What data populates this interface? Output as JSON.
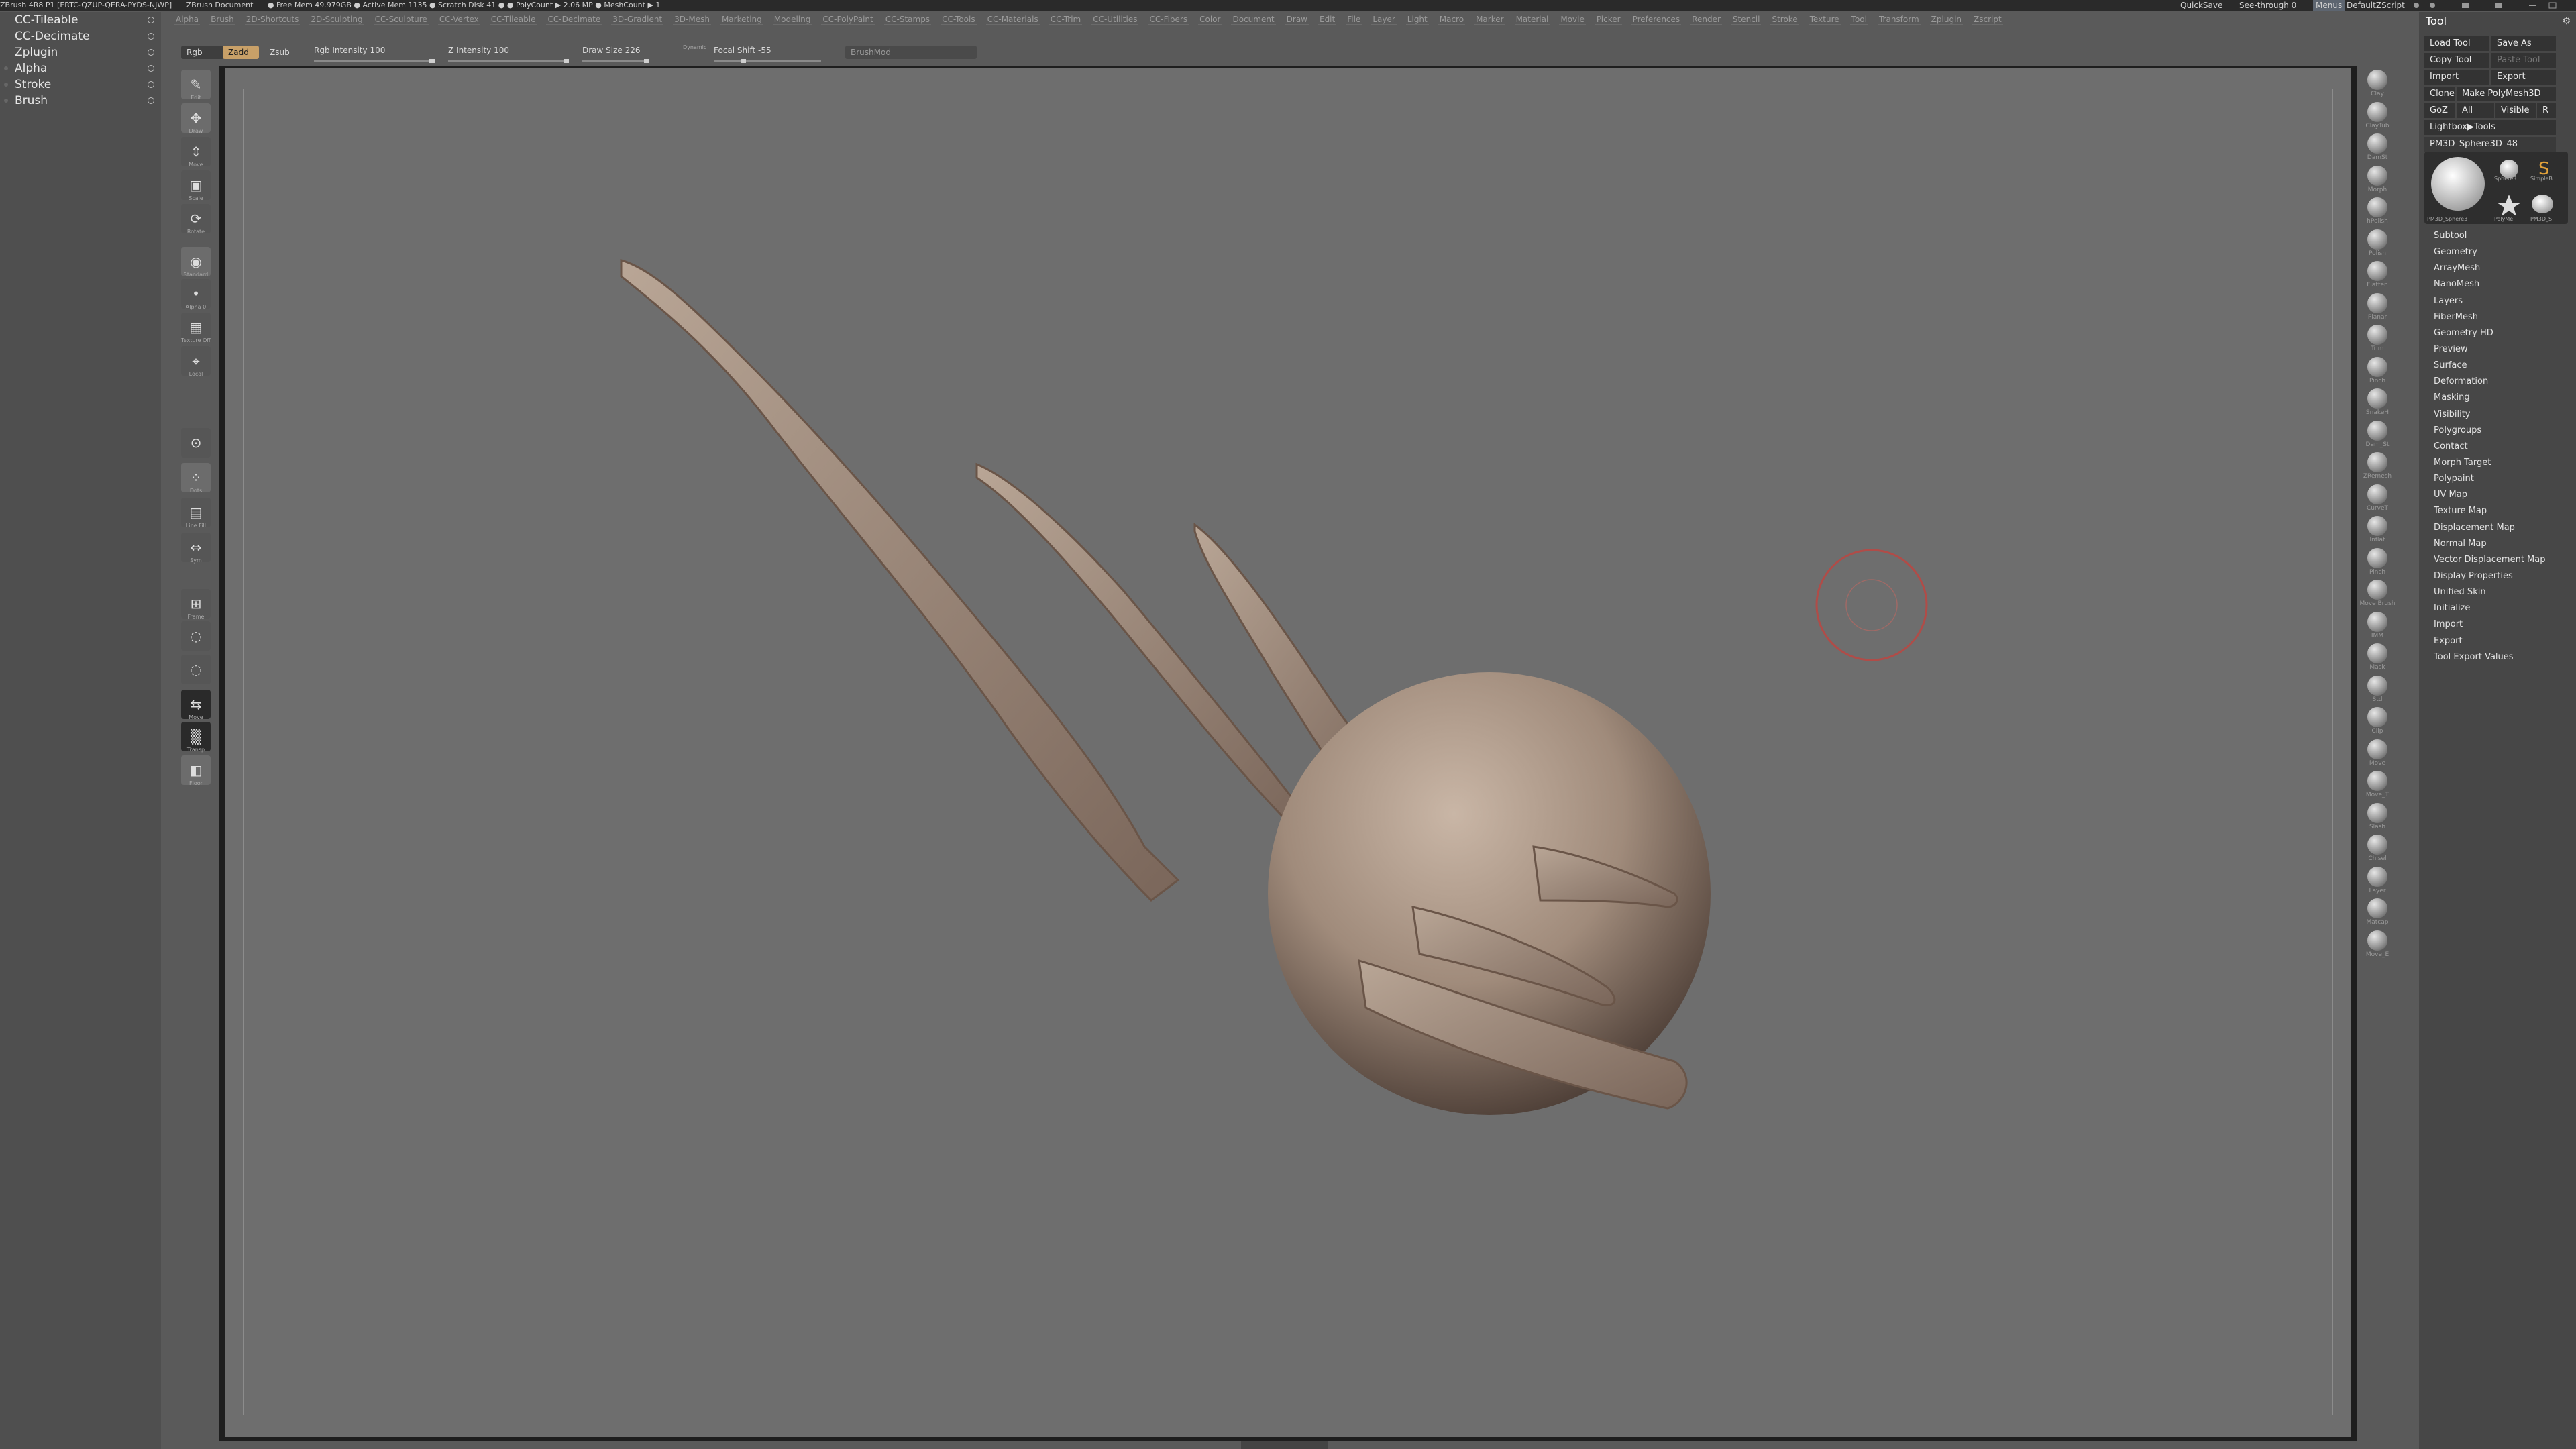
{
  "titlebar": {
    "app": "ZBrush 4R8 P1 [ERTC-QZUP-QERA-PYDS-NJWP]",
    "doc": "ZBrush Document",
    "stats": "● Free Mem 49.979GB ● Active Mem 1135 ● Scratch Disk 41 ● ● PolyCount ▶ 2.06 MP ● MeshCount ▶ 1",
    "quicksave": "QuickSave",
    "seethrough": "See-through 0",
    "menus": "Menus",
    "script": "DefaultZScript"
  },
  "menubar": [
    "Alpha",
    "Brush",
    "2D-Shortcuts",
    "2D-Sculpting",
    "CC-Sculpture",
    "CC-Vertex",
    "CC-Tileable",
    "CC-Decimate",
    "3D-Gradient",
    "3D-Mesh",
    "Marketing",
    "Modeling",
    "CC-PolyPaint",
    "CC-Stamps",
    "CC-Tools",
    "CC-Materials",
    "CC-Trim",
    "CC-Utilities",
    "CC-Fibers",
    "Color",
    "Document",
    "Draw",
    "Edit",
    "File",
    "Layer",
    "Light",
    "Macro",
    "Marker",
    "Material",
    "Movie",
    "Picker",
    "Preferences",
    "Render",
    "Stencil",
    "Stroke",
    "Texture",
    "Tool",
    "Transform",
    "Zplugin",
    "Zscript"
  ],
  "left_palettes": [
    {
      "label": "CC-Tileable",
      "marker": false
    },
    {
      "label": "CC-Decimate",
      "marker": false
    },
    {
      "label": "Zplugin",
      "marker": false
    },
    {
      "label": "Alpha",
      "marker": true
    },
    {
      "label": "Stroke",
      "marker": true
    },
    {
      "label": "Brush",
      "marker": true
    }
  ],
  "topshelf": {
    "rgb": "Rgb",
    "zadd": "Zadd",
    "zsub": "Zsub",
    "rgb_intensity_label": "Rgb Intensity",
    "rgb_intensity": "100",
    "z_intensity_label": "Z Intensity",
    "z_intensity": "100",
    "draw_size_label": "Draw Size",
    "draw_size": "226",
    "dynamic": "Dynamic",
    "focal_shift_label": "Focal Shift",
    "focal_shift": "-55",
    "brush_mod": "BrushMod"
  },
  "left_toolbar": [
    "Edit",
    "Draw",
    "Move",
    "Scale",
    "Rotate",
    "Standard",
    "Alpha 0",
    "Texture Off",
    "Local",
    "",
    "Dots",
    "Line Fill",
    "Sym",
    "Frame",
    "",
    "",
    "Move",
    "Transp",
    "Floor"
  ],
  "right_brushes": [
    "Clay",
    "ClayTub",
    "DamSt",
    "Morph",
    "hPolish",
    "Polish",
    "Flatten",
    "Planar",
    "Trim",
    "Pinch",
    "SnakeH",
    "Dam_St",
    "ZRemesh",
    "CurveT",
    "Inflat",
    "Pinch",
    "Move Brush",
    "IMM",
    "Mask",
    "Std",
    "Clip",
    "Move",
    "Move_T",
    "Slash",
    "Chisel",
    "Layer",
    "Matcap",
    "Move_E"
  ],
  "toolpanel": {
    "title": "Tool",
    "load_tool": "Load Tool",
    "save_as": "Save As",
    "copy_tool": "Copy Tool",
    "paste_tool": "Paste Tool",
    "import": "Import",
    "export": "Export",
    "clone": "Clone",
    "make_polymesh": "Make PolyMesh3D",
    "goz": "GoZ",
    "all": "All",
    "visible": "Visible",
    "r": "R",
    "lightbox_tools": "Lightbox▶Tools",
    "current_tool": "PM3D_Sphere3D_48",
    "thumb1": "PM3D_Sphere3",
    "thumb2": "Sphere3",
    "thumb3": "SimpleB",
    "thumb4": "PolyMe",
    "thumb5": "PM3D_S",
    "sections": [
      "Subtool",
      "Geometry",
      "ArrayMesh",
      "NanoMesh",
      "Layers",
      "FiberMesh",
      "Geometry HD",
      "Preview",
      "Surface",
      "Deformation",
      "Masking",
      "Visibility",
      "Polygroups",
      "Contact",
      "Morph Target",
      "Polypaint",
      "UV Map",
      "Texture Map",
      "Displacement Map",
      "Normal Map",
      "Vector Displacement Map",
      "Display Properties",
      "Unified Skin",
      "Initialize",
      "Import",
      "Export",
      "Tool Export Values"
    ]
  },
  "colors": {
    "canvas_bg": "#6e6e6e",
    "clay": "#a38f80",
    "cursor_ring": "#c0504d",
    "panel_dark": "#333333"
  },
  "icons": {
    "gear": "gear-icon",
    "palette_circle": "circle-icon",
    "star": "star-icon"
  }
}
